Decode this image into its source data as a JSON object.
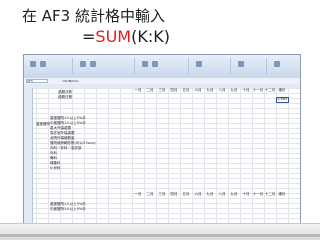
{
  "slide": {
    "headline": "在 AF3 統計格中輸入",
    "formula": {
      "prefix": "=",
      "function": "SUM",
      "args": "(K:K)"
    }
  },
  "spreadsheet": {
    "name_box": "AF3",
    "formula_value": "=SUM(K:K)",
    "months_header": [
      "一月",
      "二月",
      "三月",
      "四月",
      "五月",
      "六月",
      "七月",
      "八月",
      "九月",
      "十月",
      "十一月",
      "十二月",
      "總計"
    ],
    "row_labels_top": [
      "過期次數",
      "過期日期"
    ],
    "row_labels_mid": [
      "重度醫院1人以上5%手",
      "中度醫院1人以上5%手",
      "重大外傷處置",
      "急診室外傷處置",
      "全院外傷總數量",
      "醫院病房轉診數(可以3 hour)",
      "內科－非科－急診部",
      "外科",
      "骨科",
      "婦產科",
      "小兒科"
    ],
    "group_label": "重度醫院",
    "row_labels_bottom": [
      "重度醫院1人以上5%手",
      "中度醫院1人以上5%手"
    ],
    "total_value": "1,583"
  },
  "colors": {
    "function_highlight": "#e41c1c",
    "selection": "#2d5a9a"
  }
}
